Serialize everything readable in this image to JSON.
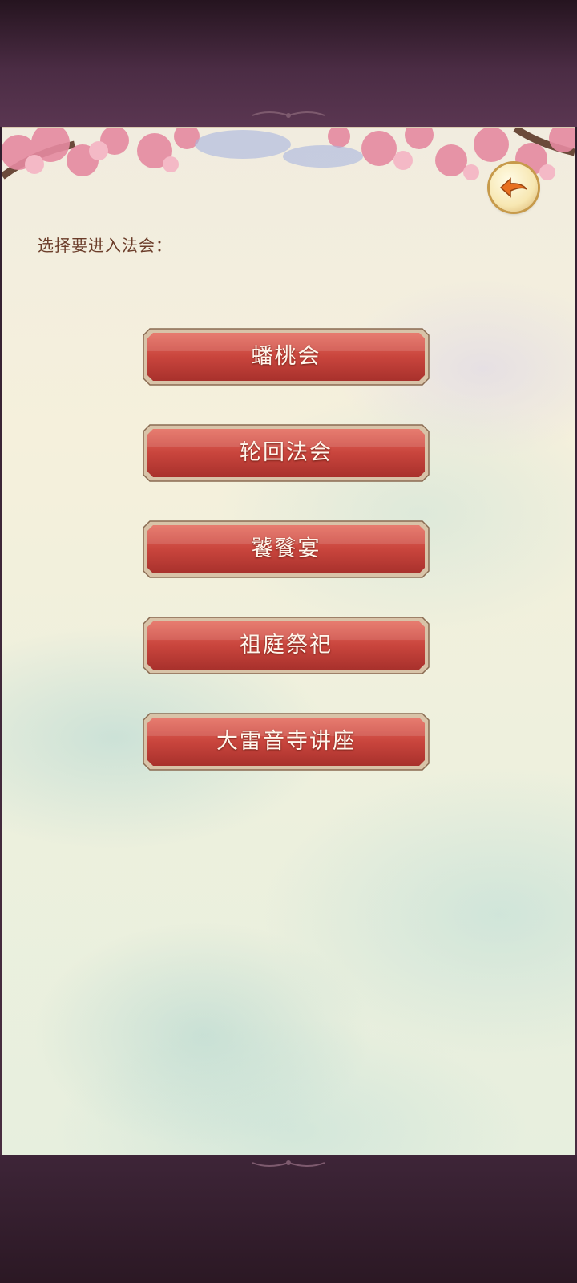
{
  "screen": {
    "prompt": "选择要进入法会：",
    "back_icon": "back-arrow-icon"
  },
  "menu": {
    "items": [
      {
        "label": "蟠桃会"
      },
      {
        "label": "轮回法会"
      },
      {
        "label": "饕餮宴"
      },
      {
        "label": "祖庭祭祀"
      },
      {
        "label": "大雷音寺讲座"
      }
    ]
  },
  "colors": {
    "button_red": "#c9453d",
    "button_border": "#d8c3a8",
    "prompt_text": "#6b3d2a",
    "frame_purple": "#4a2e42"
  }
}
